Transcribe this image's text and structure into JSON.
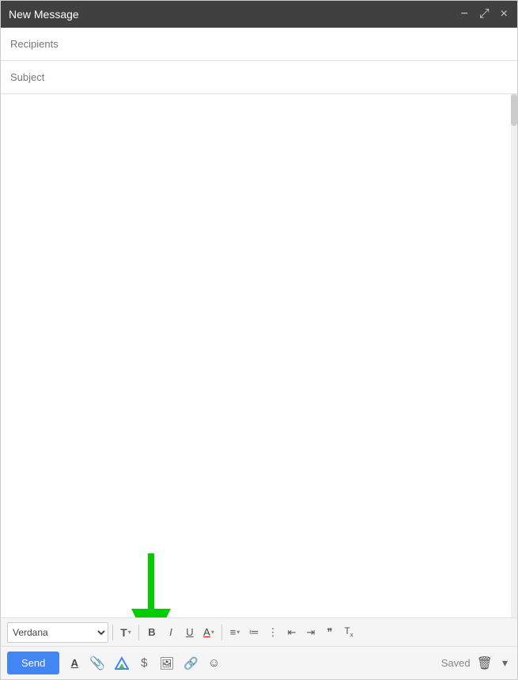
{
  "window": {
    "title": "New Message",
    "minimize_label": "−",
    "restore_label": "⤢",
    "close_label": "×"
  },
  "fields": {
    "recipients_placeholder": "Recipients",
    "subject_placeholder": "Subject"
  },
  "body": {
    "placeholder": ""
  },
  "toolbar_formatting": {
    "font": "Verdana",
    "font_size_icon": "T",
    "bold": "B",
    "italic": "I",
    "underline": "U",
    "font_color": "A",
    "align": "≡",
    "numbered_list": "1.",
    "bullet_list": "•",
    "indent_less": "⇤",
    "indent_more": "⇥",
    "quote": "❝",
    "remove_format": "Tx"
  },
  "toolbar_bottom": {
    "send_label": "Send",
    "formatting_label": "A",
    "attach_label": "📎",
    "drive_label": "▲",
    "money_label": "$",
    "photo_label": "🖼",
    "link_label": "🔗",
    "emoji_label": "☺",
    "saved_label": "Saved",
    "delete_label": "🗑",
    "more_label": "▾"
  }
}
